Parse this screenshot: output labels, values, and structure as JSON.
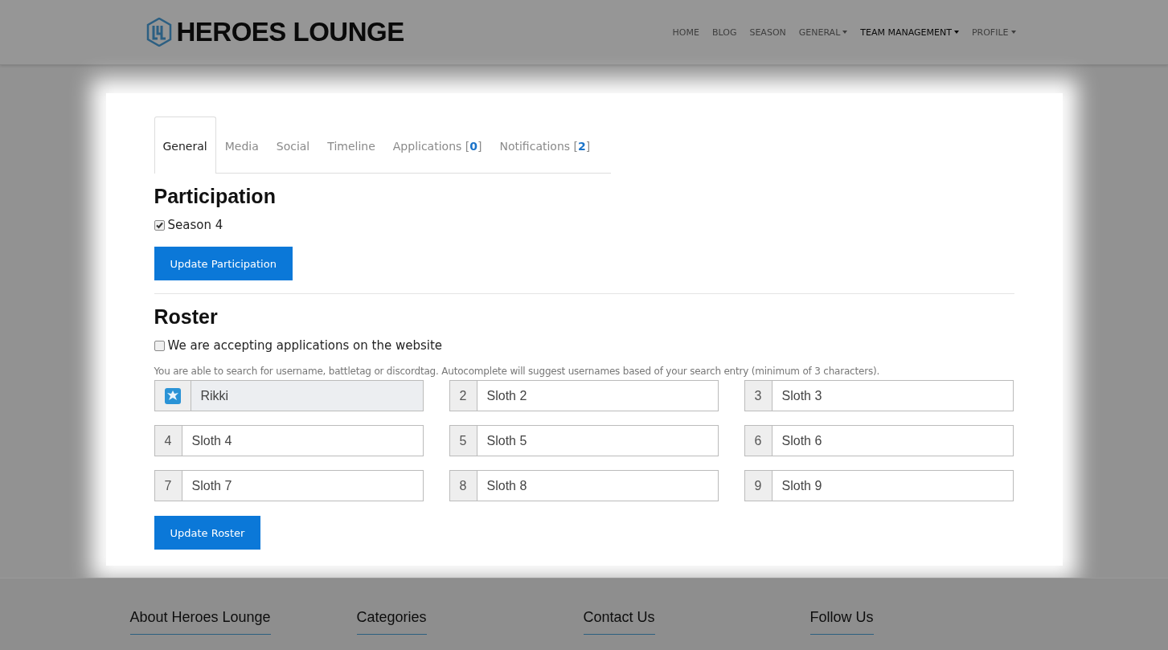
{
  "header": {
    "logo": "HEROES LOUNGE",
    "nav": [
      {
        "label": "HOME",
        "dropdown": false,
        "selected": false
      },
      {
        "label": "BLOG",
        "dropdown": false,
        "selected": false
      },
      {
        "label": "SEASON",
        "dropdown": false,
        "selected": false
      },
      {
        "label": "GENERAL",
        "dropdown": true,
        "selected": false
      },
      {
        "label": "TEAM MANAGEMENT",
        "dropdown": true,
        "selected": true
      },
      {
        "label": "PROFILE",
        "dropdown": true,
        "selected": false
      }
    ]
  },
  "tabs": [
    {
      "label": "General",
      "selected": true
    },
    {
      "label": "Media",
      "selected": false
    },
    {
      "label": "Social",
      "selected": false
    },
    {
      "label": "Timeline",
      "selected": false
    },
    {
      "label": "Applications [**0**]",
      "selected": false
    },
    {
      "label": "Notifications [**2**]",
      "selected": false
    }
  ],
  "participation": {
    "title": "Participation",
    "options": [
      {
        "label": "Season 4",
        "checked": true
      }
    ],
    "button": "Update Participation"
  },
  "roster": {
    "title": "Roster",
    "accepting": {
      "label": "We are accepting applications on the website",
      "checked": false
    },
    "help": "You are able to search for username, battletag or discordtag. Autocomplete will suggest usernames based of your search entry (minimum of 3 characters).",
    "slots": [
      {
        "kind": "avatar",
        "value": "Rikki",
        "disabled": true
      },
      {
        "kind": "number",
        "number": "2",
        "value": "Sloth 2",
        "disabled": false
      },
      {
        "kind": "number",
        "number": "3",
        "value": "Sloth 3",
        "disabled": false
      },
      {
        "kind": "number",
        "number": "4",
        "value": "Sloth 4",
        "disabled": false
      },
      {
        "kind": "number",
        "number": "5",
        "value": "Sloth 5",
        "disabled": false
      },
      {
        "kind": "number",
        "number": "6",
        "value": "Sloth 6",
        "disabled": false
      },
      {
        "kind": "number",
        "number": "7",
        "value": "Sloth 7",
        "disabled": false
      },
      {
        "kind": "number",
        "number": "8",
        "value": "Sloth 8",
        "disabled": false
      },
      {
        "kind": "number",
        "number": "9",
        "value": "Sloth 9",
        "disabled": false
      }
    ],
    "button": "Update Roster"
  },
  "footer": {
    "headings": [
      "About Heroes Lounge",
      "Categories",
      "Contact Us",
      "Follow Us"
    ]
  }
}
